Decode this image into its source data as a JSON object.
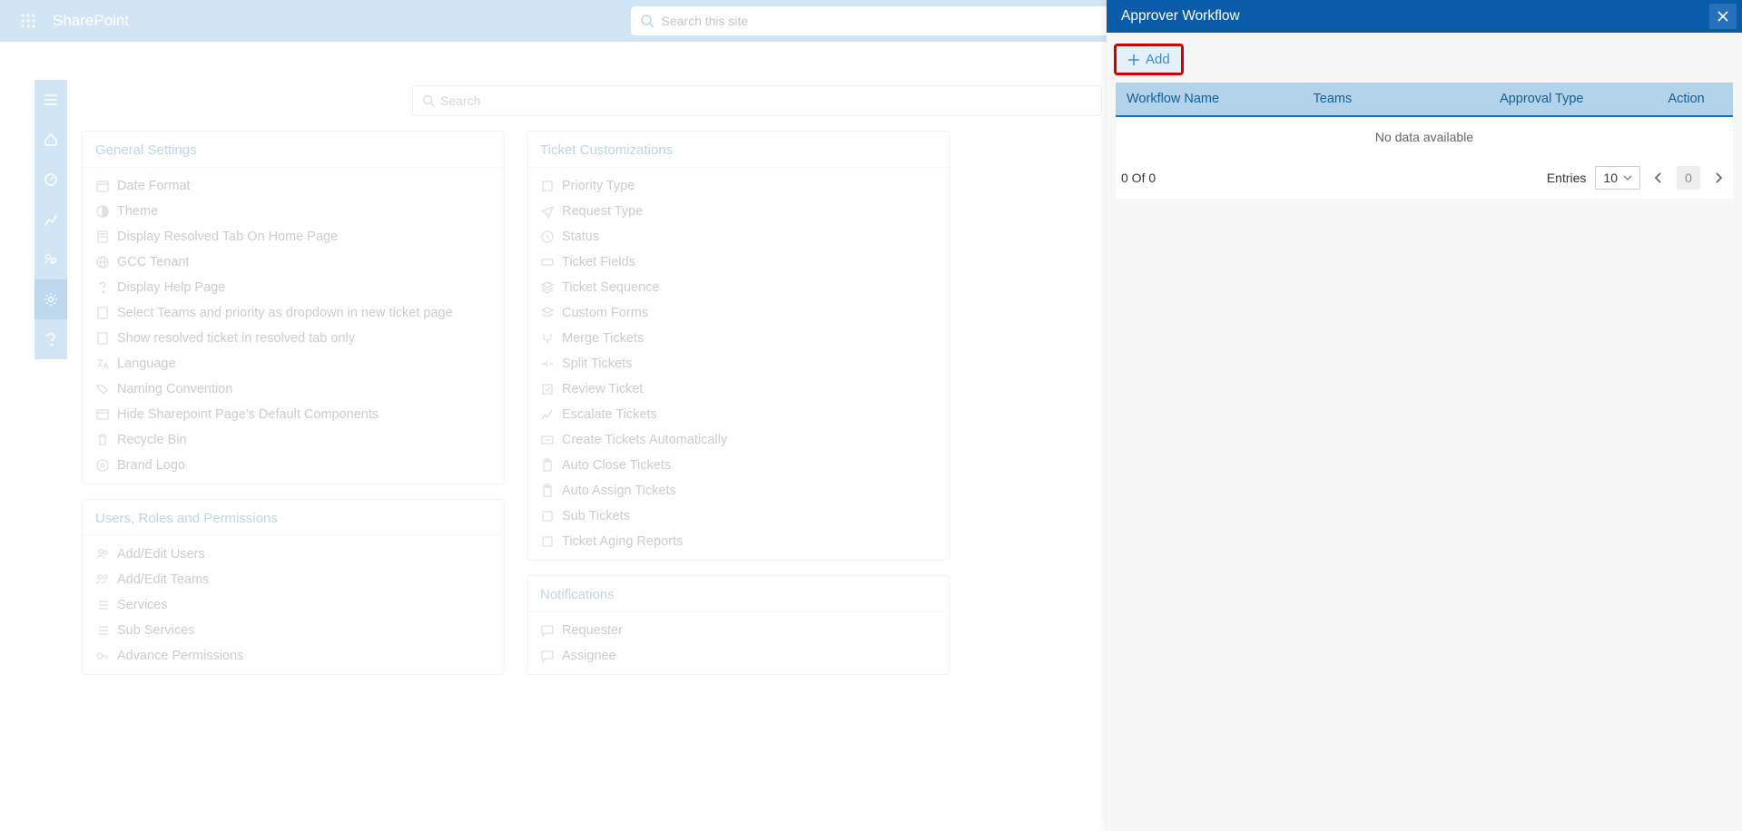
{
  "header": {
    "app_title": "SharePoint",
    "search_placeholder": "Search this site"
  },
  "content_search": {
    "placeholder": "Search"
  },
  "columns": [
    {
      "title": "General Settings",
      "items": [
        "Date Format",
        "Theme",
        "Display Resolved Tab On Home Page",
        "GCC Tenant",
        "Display Help Page",
        "Select Teams and priority as dropdown in new ticket page",
        "Show resolved ticket in resolved tab only",
        "Language",
        "Naming Convention",
        "Hide Sharepoint Page's Default Components",
        "Recycle Bin",
        "Brand Logo"
      ]
    },
    {
      "title": "Users, Roles and Permissions",
      "items": [
        "Add/Edit Users",
        "Add/Edit Teams",
        "Services",
        "Sub Services",
        "Advance Permissions"
      ]
    },
    {
      "title": "Ticket Customizations",
      "items": [
        "Priority Type",
        "Request Type",
        "Status",
        "Ticket Fields",
        "Ticket Sequence",
        "Custom Forms",
        "Merge Tickets",
        "Split Tickets",
        "Review Ticket",
        "Escalate Tickets",
        "Create Tickets Automatically",
        "Auto Close Tickets",
        "Auto Assign Tickets",
        "Sub Tickets",
        "Ticket Aging Reports"
      ]
    },
    {
      "title": "Notifications",
      "items": [
        "Requester",
        "Assignee"
      ]
    }
  ],
  "panel": {
    "title": "Approver Workflow",
    "add_label": "Add",
    "cols": {
      "c1": "Workflow Name",
      "c2": "Teams",
      "c3": "Approval Type",
      "c4": "Action"
    },
    "no_data": "No data available",
    "pager_left": "0 Of 0",
    "entries_label": "Entries",
    "entries_value": "10",
    "page_num": "0"
  }
}
